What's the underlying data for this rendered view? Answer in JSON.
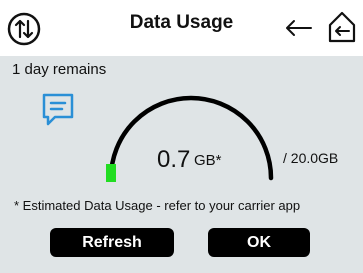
{
  "header": {
    "title": "Data Usage",
    "icons": [
      "data-transfer-icon",
      "back-arrow-icon",
      "home-back-icon"
    ]
  },
  "usage": {
    "remaining_text": "1 day remains",
    "used_value": "0.7",
    "used_unit": "GB*",
    "total_text": "/ 20.0GB",
    "used_gb": 0.7,
    "total_gb": 20.0,
    "gauge_color": "#22dd22"
  },
  "note": "* Estimated Data Usage - refer to your carrier app",
  "buttons": {
    "refresh_label": "Refresh",
    "ok_label": "OK"
  },
  "colors": {
    "background": "#dfe4e6",
    "header_bg": "#ffffff",
    "message_icon": "#2a8fd6",
    "button_bg": "#000000",
    "button_text": "#ffffff"
  }
}
